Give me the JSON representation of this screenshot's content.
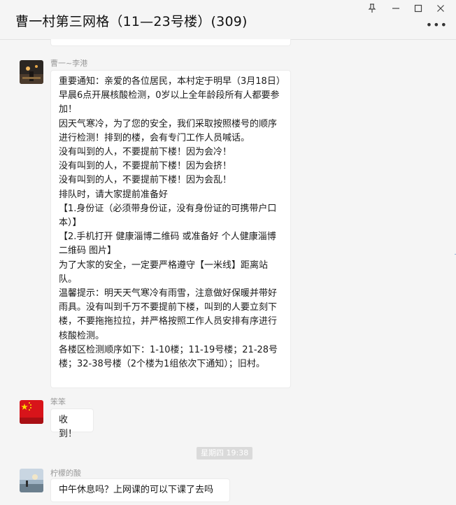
{
  "window": {
    "title": "曹一村第三网格（11—23号楼）(309)",
    "pin_icon": "pin-icon",
    "minimize_icon": "minimize-icon",
    "maximize_icon": "maximize-icon",
    "close_icon": "close-icon",
    "more_icon": "more-icon"
  },
  "messages": [
    {
      "sender": "曹一~李港",
      "text": "重要通知：亲爱的各位居民，本村定于明早（3月18日）早晨6点开展核酸检测，0岁以上全年龄段所有人都要参加！\n因天气寒冷，为了您的安全，我们采取按照楼号的顺序进行检测！排到的楼，会有专门工作人员喊话。\n没有叫到的人，不要提前下楼！因为会冷！\n没有叫到的人，不要提前下楼！因为会挤！\n没有叫到的人，不要提前下楼！因为会乱！\n排队时，请大家提前准备好\n【1.身份证（必须带身份证，没有身份证的可携带户口本）】\n【2.手机打开 健康淄博二维码 或准备好 个人健康淄博二维码 图片】\n为了大家的安全，一定要严格遵守【一米线】距离站队。\n温馨提示：明天天气寒冷有雨雪，注意做好保暖并带好雨具。没有叫到千万不要提前下楼，叫到的人要立刻下楼，不要拖拖拉拉，并严格按照工作人员安排有序进行核酸检测。\n各楼区检测顺序如下：1-10楼；11-19号楼；21-28号楼；32-38号楼（2个楼为1组依次下通知）；旧村。"
    },
    {
      "sender": "笨笨",
      "text": "收到！",
      "avatar_caption": "中国加油"
    },
    {
      "sender": "柠檬的酸",
      "text": "中午休息吗？上网课的可以下课了去吗"
    }
  ],
  "timestamp": "星期四 19:38",
  "colors": {
    "background": "#f5f5f5",
    "bubble": "#ffffff",
    "timestamp_bg": "#dadada",
    "flag_red": "#d8141a",
    "flag_yellow": "#ffde00"
  }
}
